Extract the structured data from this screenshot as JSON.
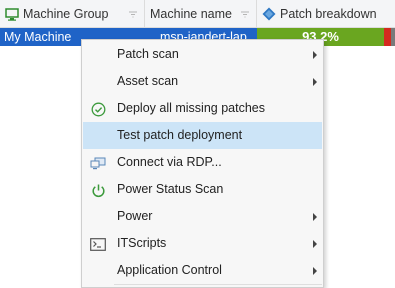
{
  "columns": [
    {
      "label": "Machine Group",
      "icon": "monitor-icon"
    },
    {
      "label": "Machine name",
      "icon": "filter-icon"
    },
    {
      "label": "Patch breakdown",
      "icon": "diamond-icon"
    }
  ],
  "row": {
    "machine_group": "My Machine",
    "machine_name": "msp-iandert-lap",
    "patch_percent": "93.2%",
    "patch_fraction": 0.932,
    "colors": {
      "selected_bg": "#1f63c7",
      "patched": "#6aa620",
      "missing": "#d42a1f"
    }
  },
  "context_menu": {
    "items": [
      {
        "label": "Patch scan",
        "icon": "",
        "submenu": true
      },
      {
        "label": "Asset scan",
        "icon": "",
        "submenu": true
      },
      {
        "label": "Deploy all missing patches",
        "icon": "check-circle-icon",
        "submenu": false
      },
      {
        "label": "Test patch deployment",
        "icon": "",
        "submenu": false,
        "highlighted": true
      },
      {
        "label": "Connect via RDP...",
        "icon": "rdp-icon",
        "submenu": false
      },
      {
        "label": "Power Status Scan",
        "icon": "power-icon",
        "submenu": false
      },
      {
        "label": "Power",
        "icon": "",
        "submenu": true
      },
      {
        "label": "ITScripts",
        "icon": "terminal-icon",
        "submenu": true
      },
      {
        "label": "Application Control",
        "icon": "",
        "submenu": true
      }
    ]
  }
}
